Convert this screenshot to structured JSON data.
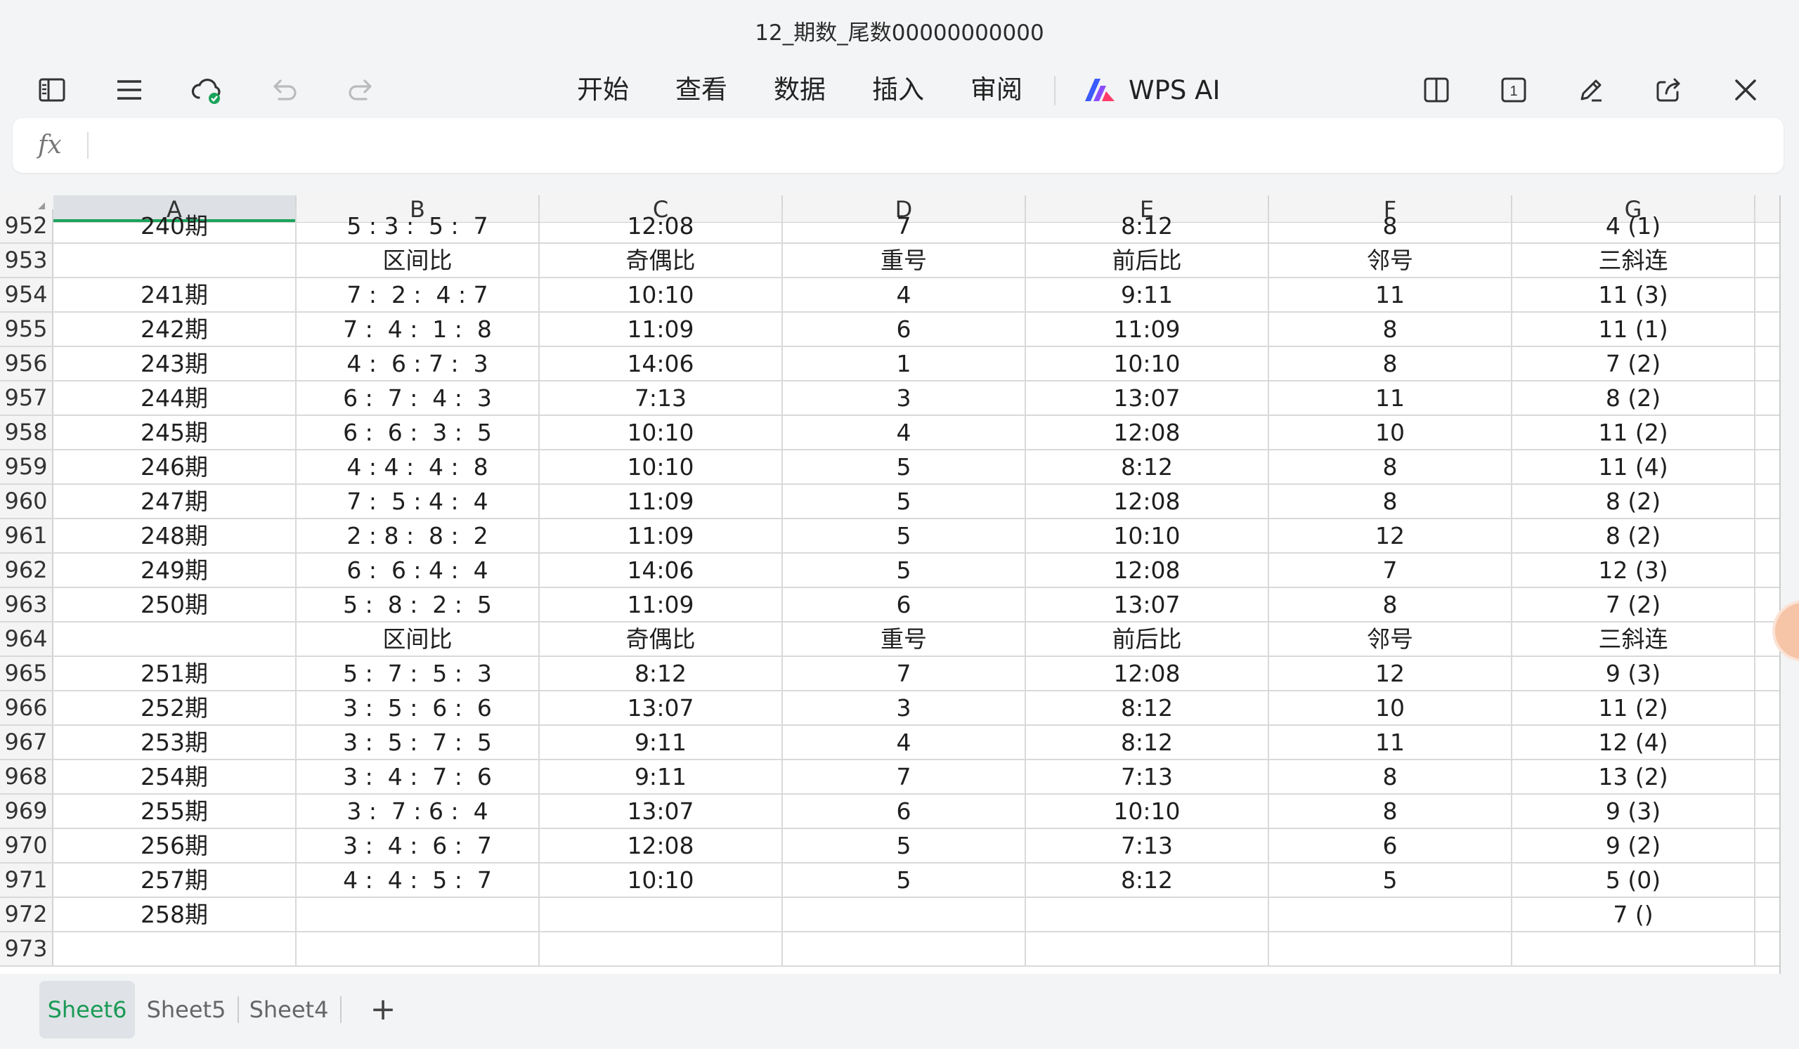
{
  "window": {
    "title": "12_期数_尾数00000000000"
  },
  "toolbar": {
    "menu": [
      "开始",
      "查看",
      "数据",
      "插入",
      "审阅"
    ],
    "ai_label": "WPS AI",
    "page_count_badge": "1"
  },
  "icons": {
    "left": [
      "sidebar-icon",
      "menu-icon",
      "cloud-synced-icon",
      "undo-icon",
      "redo-icon"
    ],
    "right": [
      "split-view-icon",
      "page-count-icon",
      "pen-icon",
      "share-icon",
      "close-icon"
    ],
    "accent_green": "#1aa35b"
  },
  "formula_bar": {
    "fx_label": "fx",
    "value": ""
  },
  "sheet": {
    "columns": [
      "A",
      "B",
      "C",
      "D",
      "E",
      "F",
      "G"
    ],
    "rows": [
      {
        "num": "952",
        "cells": [
          "240期",
          "5 : 3 :  5 :  7",
          "12:08",
          "7",
          "8:12",
          "8",
          "4 (1)"
        ]
      },
      {
        "num": "953",
        "cells": [
          "",
          "区间比",
          "奇偶比",
          "重号",
          "前后比",
          "邻号",
          "三斜连"
        ]
      },
      {
        "num": "954",
        "cells": [
          "241期",
          "7 :  2 :  4 : 7",
          "10:10",
          "4",
          "9:11",
          "11",
          "11 (3)"
        ]
      },
      {
        "num": "955",
        "cells": [
          "242期",
          "7 :  4 :  1 :  8",
          "11:09",
          "6",
          "11:09",
          "8",
          "11 (1)"
        ]
      },
      {
        "num": "956",
        "cells": [
          "243期",
          "4 :  6 : 7 :  3",
          "14:06",
          "1",
          "10:10",
          "8",
          "7 (2)"
        ]
      },
      {
        "num": "957",
        "cells": [
          "244期",
          "6 :  7 :  4 :  3",
          "7:13",
          "3",
          "13:07",
          "11",
          "8 (2)"
        ]
      },
      {
        "num": "958",
        "cells": [
          "245期",
          "6 :  6 :  3 :  5",
          "10:10",
          "4",
          "12:08",
          "10",
          "11 (2)"
        ]
      },
      {
        "num": "959",
        "cells": [
          "246期",
          "4 : 4 :  4 :  8",
          "10:10",
          "5",
          "8:12",
          "8",
          "11 (4)"
        ]
      },
      {
        "num": "960",
        "cells": [
          "247期",
          "7 :  5 : 4 :  4",
          "11:09",
          "5",
          "12:08",
          "8",
          "8 (2)"
        ]
      },
      {
        "num": "961",
        "cells": [
          "248期",
          "2 : 8 :  8 :  2",
          "11:09",
          "5",
          "10:10",
          "12",
          "8 (2)"
        ]
      },
      {
        "num": "962",
        "cells": [
          "249期",
          "6 :  6 : 4 :  4",
          "14:06",
          "5",
          "12:08",
          "7",
          "12 (3)"
        ]
      },
      {
        "num": "963",
        "cells": [
          "250期",
          "5 :  8 :  2 :  5",
          "11:09",
          "6",
          "13:07",
          "8",
          "7 (2)"
        ]
      },
      {
        "num": "964",
        "cells": [
          "",
          "区间比",
          "奇偶比",
          "重号",
          "前后比",
          "邻号",
          "三斜连"
        ]
      },
      {
        "num": "965",
        "cells": [
          "251期",
          "5 :  7 :  5 :  3",
          "8:12",
          "7",
          "12:08",
          "12",
          "9 (3)"
        ]
      },
      {
        "num": "966",
        "cells": [
          "252期",
          "3 :  5 :  6 :  6",
          "13:07",
          "3",
          "8:12",
          "10",
          "11 (2)"
        ]
      },
      {
        "num": "967",
        "cells": [
          "253期",
          "3 :  5 :  7 :  5",
          "9:11",
          "4",
          "8:12",
          "11",
          "12 (4)"
        ]
      },
      {
        "num": "968",
        "cells": [
          "254期",
          "3 :  4 :  7 :  6",
          "9:11",
          "7",
          "7:13",
          "8",
          "13 (2)"
        ]
      },
      {
        "num": "969",
        "cells": [
          "255期",
          "3 :  7 : 6 :  4",
          "13:07",
          "6",
          "10:10",
          "8",
          "9 (3)"
        ]
      },
      {
        "num": "970",
        "cells": [
          "256期",
          "3 :  4 :  6 :  7",
          "12:08",
          "5",
          "7:13",
          "6",
          "9 (2)"
        ]
      },
      {
        "num": "971",
        "cells": [
          "257期",
          "4 :  4 :  5 :  7",
          "10:10",
          "5",
          "8:12",
          "5",
          "5 (0)"
        ]
      },
      {
        "num": "972",
        "cells": [
          "258期",
          "",
          "",
          "",
          "",
          "",
          "7 ()"
        ]
      },
      {
        "num": "973",
        "cells": [
          "",
          "",
          "",
          "",
          "",
          "",
          ""
        ]
      }
    ]
  },
  "tabs": {
    "items": [
      "Sheet6",
      "Sheet5",
      "Sheet4"
    ],
    "active": "Sheet6",
    "add_label": "+"
  }
}
